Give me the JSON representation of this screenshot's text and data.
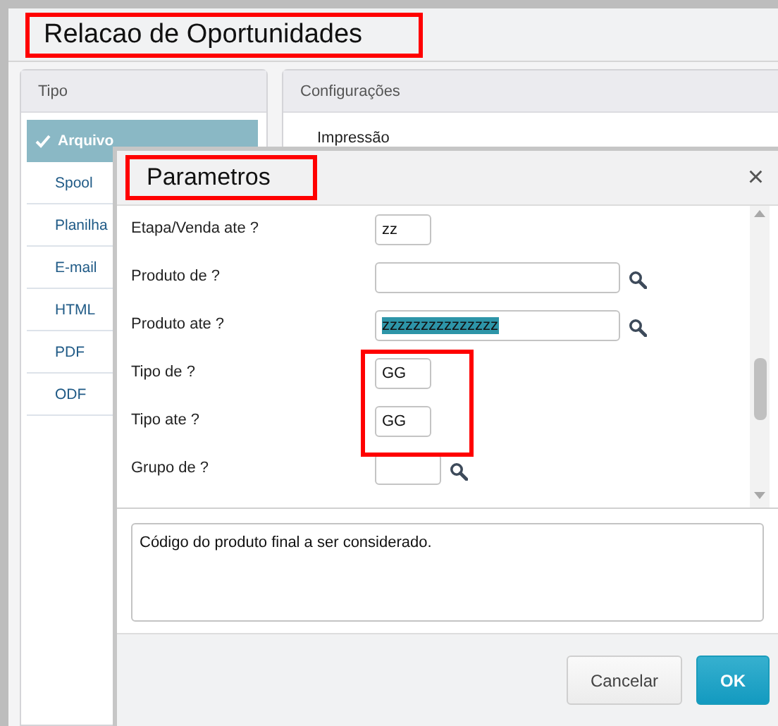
{
  "window": {
    "title": "Relacao de Oportunidades",
    "title_highlighted": true
  },
  "type_panel": {
    "header": "Tipo",
    "items": [
      {
        "label": "Arquivo",
        "selected": true
      },
      {
        "label": "Spool",
        "selected": false
      },
      {
        "label": "Planilha",
        "selected": false
      },
      {
        "label": "E-mail",
        "selected": false
      },
      {
        "label": "HTML",
        "selected": false
      },
      {
        "label": "PDF",
        "selected": false
      },
      {
        "label": "ODF",
        "selected": false
      }
    ]
  },
  "config_panel": {
    "header": "Configurações",
    "section": "Impressão"
  },
  "dialog": {
    "title": "Parametros",
    "title_highlighted": true,
    "close": "×",
    "params": [
      {
        "label": "Etapa/Venda ate ?",
        "value": "zz",
        "kind": "short",
        "lookup": false,
        "text_selected": false,
        "highlighted": false
      },
      {
        "label": "Produto de ?",
        "kind": "long",
        "lookup": true,
        "text_selected": false,
        "highlighted": false
      },
      {
        "label": "Produto ate ?",
        "value": "zzzzzzzzzzzzzzz",
        "kind": "long",
        "lookup": true,
        "text_selected": true,
        "highlighted": false
      },
      {
        "label": "Tipo de ?",
        "value": "GG",
        "kind": "short",
        "lookup": false,
        "text_selected": false,
        "highlighted": true
      },
      {
        "label": "Tipo ate ?",
        "value": "GG",
        "kind": "short",
        "lookup": false,
        "text_selected": false,
        "highlighted": true
      },
      {
        "label": "Grupo de ?",
        "kind": "medium",
        "lookup": true,
        "text_selected": false,
        "highlighted": false
      }
    ],
    "description": "Código do produto final a ser considerado.",
    "buttons": [
      {
        "label": "Cancelar",
        "kind": "secondary"
      },
      {
        "label": "OK",
        "kind": "primary"
      }
    ]
  }
}
